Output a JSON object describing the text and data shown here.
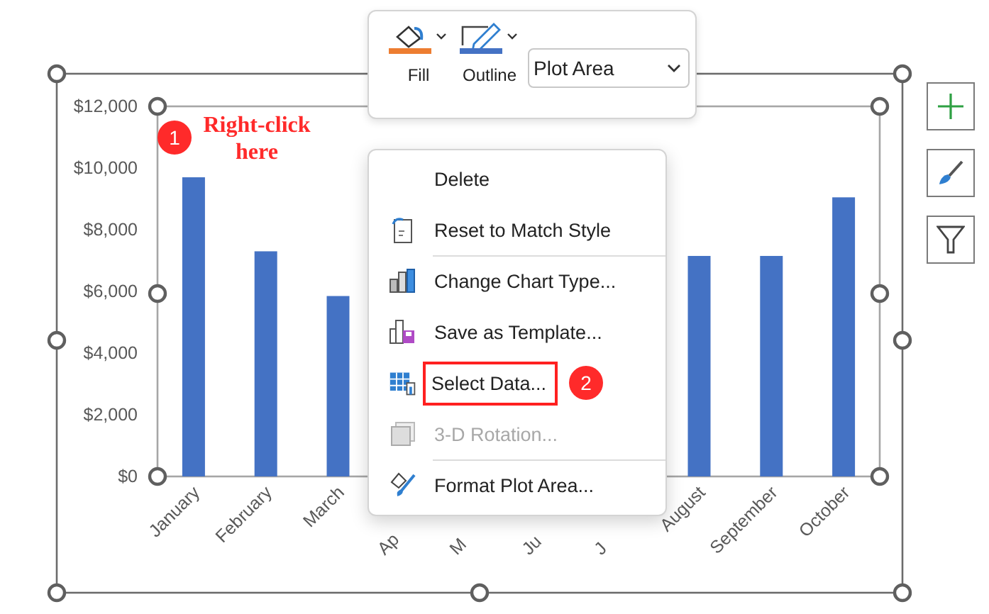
{
  "toolbar": {
    "fill_label": "Fill",
    "outline_label": "Outline",
    "element_dropdown": {
      "value": "Plot Area"
    }
  },
  "chart": {
    "chart_data": {
      "type": "bar",
      "categories": [
        "January",
        "February",
        "March",
        "Ap",
        "M",
        "Ju",
        "J",
        "August",
        "September",
        "October"
      ],
      "series": [
        {
          "color": "#4472c4",
          "values": [
            9700,
            7300,
            5850,
            null,
            null,
            null,
            null,
            7150,
            7150,
            9050
          ]
        }
      ],
      "ylim": [
        0,
        12000
      ],
      "yticks": [
        {
          "value": 0,
          "label": "$0"
        },
        {
          "value": 2000,
          "label": "$2,000"
        },
        {
          "value": 4000,
          "label": "$4,000"
        },
        {
          "value": 6000,
          "label": "$6,000"
        },
        {
          "value": 8000,
          "label": "$8,000"
        },
        {
          "value": 10000,
          "label": "$10,000"
        },
        {
          "value": 12000,
          "label": "$12,000"
        }
      ]
    }
  },
  "annotations": [
    {
      "badge": "1",
      "text": "Right-click here"
    }
  ],
  "context_menu": {
    "items": [
      {
        "label": "Delete",
        "disabled": false,
        "separator_before": false,
        "boxed": false
      },
      {
        "label": "Reset to Match Style",
        "disabled": false,
        "separator_before": false,
        "boxed": false
      },
      {
        "label": "Change Chart Type...",
        "disabled": false,
        "separator_before": true,
        "boxed": false
      },
      {
        "label": "Save as Template...",
        "disabled": false,
        "separator_before": false,
        "boxed": false
      },
      {
        "label": "Select Data...",
        "disabled": false,
        "separator_before": false,
        "boxed": true,
        "badge": "2"
      },
      {
        "label": "3-D Rotation...",
        "disabled": true,
        "separator_before": false,
        "boxed": false
      },
      {
        "label": "Format Plot Area...",
        "disabled": false,
        "separator_before": true,
        "boxed": false
      }
    ]
  }
}
